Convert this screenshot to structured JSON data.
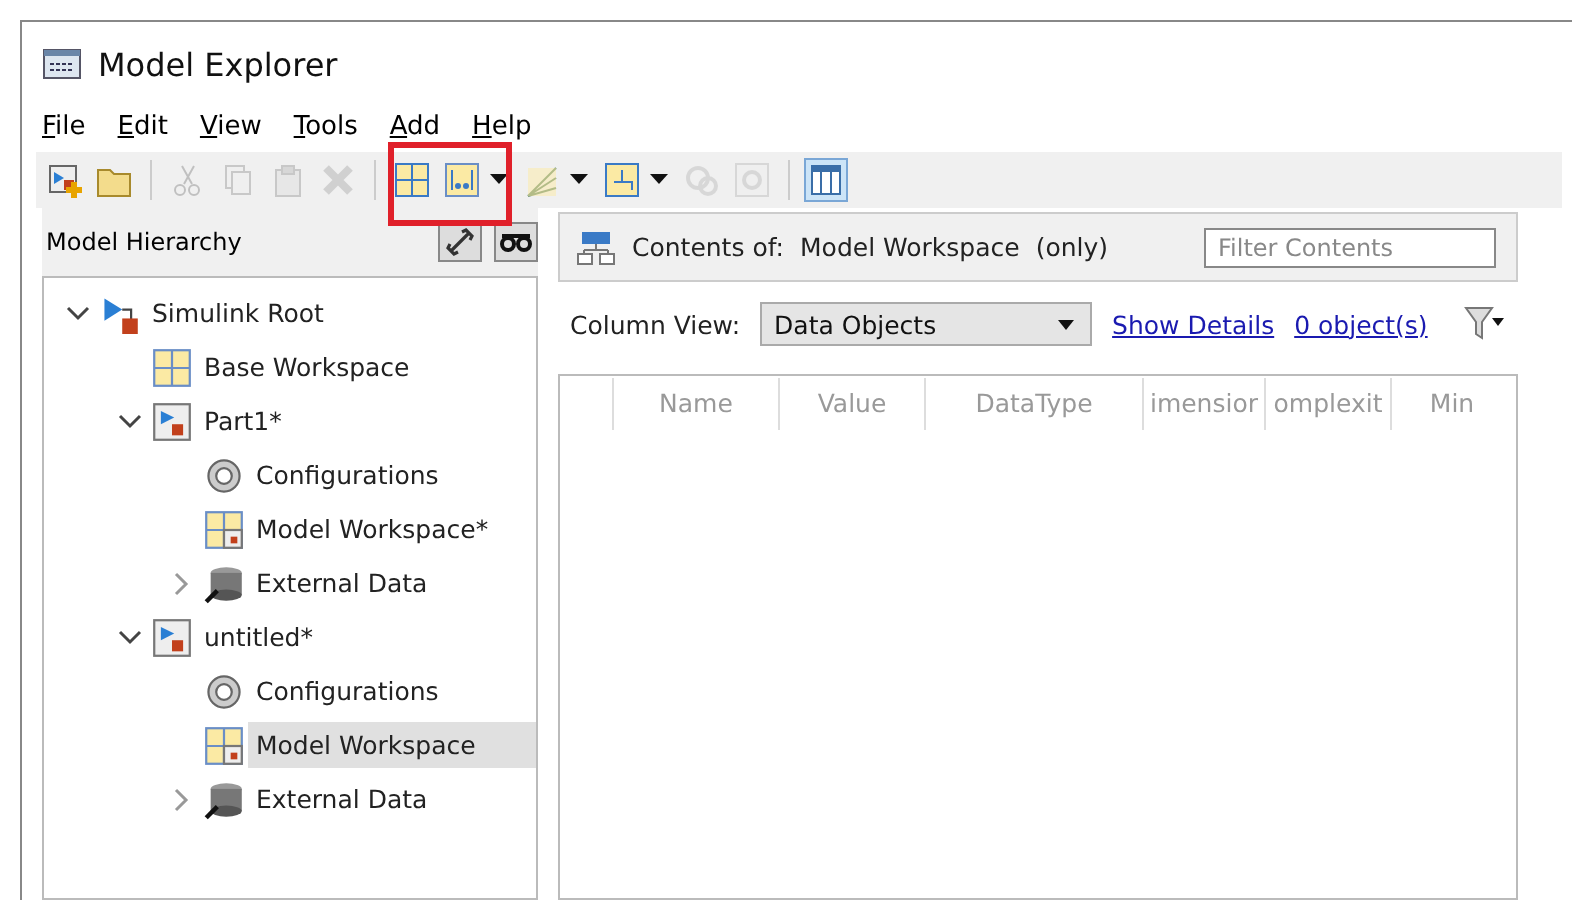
{
  "window": {
    "title": "Model Explorer"
  },
  "menu": [
    "File",
    "Edit",
    "View",
    "Tools",
    "Add",
    "Help"
  ],
  "toolbar": [
    {
      "kind": "button",
      "disabled": false
    },
    {
      "kind": "button",
      "disabled": false
    },
    {
      "kind": "separator"
    },
    {
      "kind": "button",
      "disabled": true
    },
    {
      "kind": "button",
      "disabled": true
    },
    {
      "kind": "button",
      "disabled": true
    },
    {
      "kind": "button",
      "disabled": true
    },
    {
      "kind": "separator"
    },
    {
      "kind": "button",
      "disabled": false
    },
    {
      "kind": "dropdown",
      "disabled": false
    },
    {
      "kind": "dropdown",
      "disabled": false
    },
    {
      "kind": "dropdown",
      "disabled": false
    },
    {
      "kind": "button",
      "disabled": true
    },
    {
      "kind": "button",
      "disabled": true
    },
    {
      "kind": "separator"
    },
    {
      "kind": "toggle",
      "disabled": false,
      "on": true
    }
  ],
  "highlight_box": true,
  "hierarchy": {
    "title": "Model Hierarchy",
    "tree": [
      {
        "label": "Simulink Root",
        "kind": "root",
        "expanded": true,
        "selected": false,
        "children": [
          {
            "label": "Base Workspace",
            "kind": "workspace",
            "selected": false
          },
          {
            "label": "Part1*",
            "kind": "model",
            "expanded": true,
            "selected": false,
            "children": [
              {
                "label": "Configurations",
                "kind": "config",
                "selected": false
              },
              {
                "label": "Model Workspace*",
                "kind": "model-workspace",
                "selected": false
              },
              {
                "label": "External Data",
                "kind": "data",
                "expanded": false,
                "selected": false
              }
            ]
          },
          {
            "label": "untitled*",
            "kind": "model",
            "expanded": true,
            "selected": false,
            "children": [
              {
                "label": "Configurations",
                "kind": "config",
                "selected": false
              },
              {
                "label": "Model Workspace",
                "kind": "model-workspace",
                "selected": true
              },
              {
                "label": "External Data",
                "kind": "data",
                "expanded": false,
                "selected": false
              }
            ]
          }
        ]
      }
    ]
  },
  "contents": {
    "label": "Contents of:",
    "target": "Model Workspace",
    "scope": "(only)",
    "filter": {
      "placeholder": "Filter Contents"
    },
    "column_view_label": "Column View:",
    "column_view": "Data Objects",
    "show_details": "Show Details",
    "object_count": "0 object(s)",
    "table": {
      "columns": [
        "Name",
        "Value",
        "DataType",
        "imensior",
        "omplexit",
        "Min"
      ]
    }
  }
}
